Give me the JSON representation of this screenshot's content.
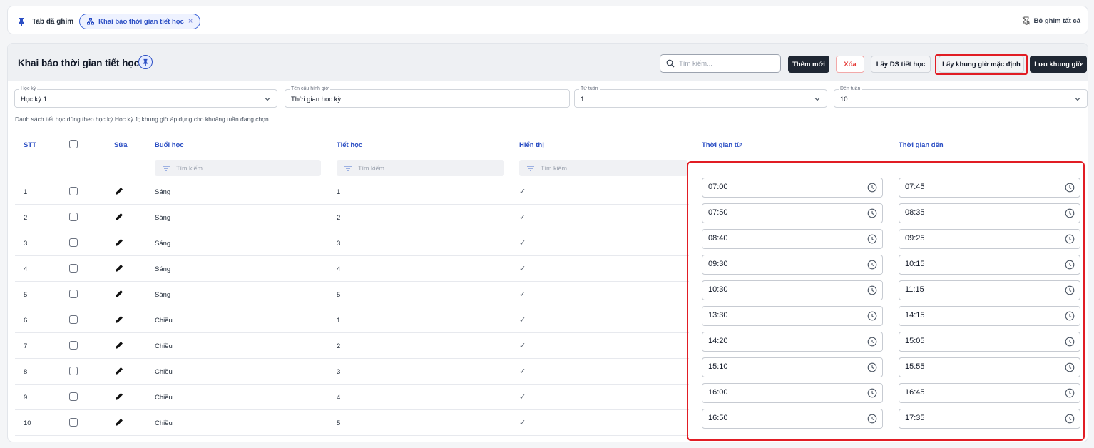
{
  "pinbar": {
    "title": "Tab đã ghim",
    "chip_label": "Khai báo thời gian tiết học",
    "chip_close": "×",
    "unpin_all": "Bỏ ghim tất cả"
  },
  "page": {
    "title": "Khai báo thời gian tiết học",
    "search_placeholder": "Tìm kiếm...",
    "buttons": {
      "add": "Thêm mới",
      "delete": "Xóa",
      "get_periods": "Lấy DS tiết học",
      "get_default": "Lấy khung giờ mặc định",
      "save": "Lưu khung giờ"
    }
  },
  "filters": {
    "semester": {
      "label": "Học kỳ",
      "value": "Học kỳ 1"
    },
    "config_name": {
      "label": "Tên cấu hình giờ",
      "value": "Thời gian học kỳ"
    },
    "from_week": {
      "label": "Từ tuần",
      "value": "1"
    },
    "to_week": {
      "label": "Đến tuần",
      "value": "10"
    }
  },
  "description": "Danh sách tiết học dùng theo học kỳ Học kỳ 1; khung giờ áp dụng cho khoảng tuần đang chọn.",
  "table": {
    "headers": {
      "stt": "STT",
      "edit": "Sửa",
      "session": "Buổi học",
      "period": "Tiết học",
      "visible": "Hiển thị",
      "time_from": "Thời gian từ",
      "time_to": "Thời gian đến"
    },
    "filter_placeholder": "Tìm kiếm...",
    "check_mark": "✓",
    "rows": [
      {
        "stt": "1",
        "session": "Sáng",
        "period": "1",
        "from": "07:00",
        "to": "07:45"
      },
      {
        "stt": "2",
        "session": "Sáng",
        "period": "2",
        "from": "07:50",
        "to": "08:35"
      },
      {
        "stt": "3",
        "session": "Sáng",
        "period": "3",
        "from": "08:40",
        "to": "09:25"
      },
      {
        "stt": "4",
        "session": "Sáng",
        "period": "4",
        "from": "09:30",
        "to": "10:15"
      },
      {
        "stt": "5",
        "session": "Sáng",
        "period": "5",
        "from": "10:30",
        "to": "11:15"
      },
      {
        "stt": "6",
        "session": "Chiều",
        "period": "1",
        "from": "13:30",
        "to": "14:15"
      },
      {
        "stt": "7",
        "session": "Chiều",
        "period": "2",
        "from": "14:20",
        "to": "15:05"
      },
      {
        "stt": "8",
        "session": "Chiều",
        "period": "3",
        "from": "15:10",
        "to": "15:55"
      },
      {
        "stt": "9",
        "session": "Chiều",
        "period": "4",
        "from": "16:00",
        "to": "16:45"
      },
      {
        "stt": "10",
        "session": "Chiều",
        "period": "5",
        "from": "16:50",
        "to": "17:35"
      }
    ]
  },
  "colors": {
    "accent": "#2c4fc4",
    "highlight": "#e11d24",
    "dark_button": "#1f2733"
  }
}
